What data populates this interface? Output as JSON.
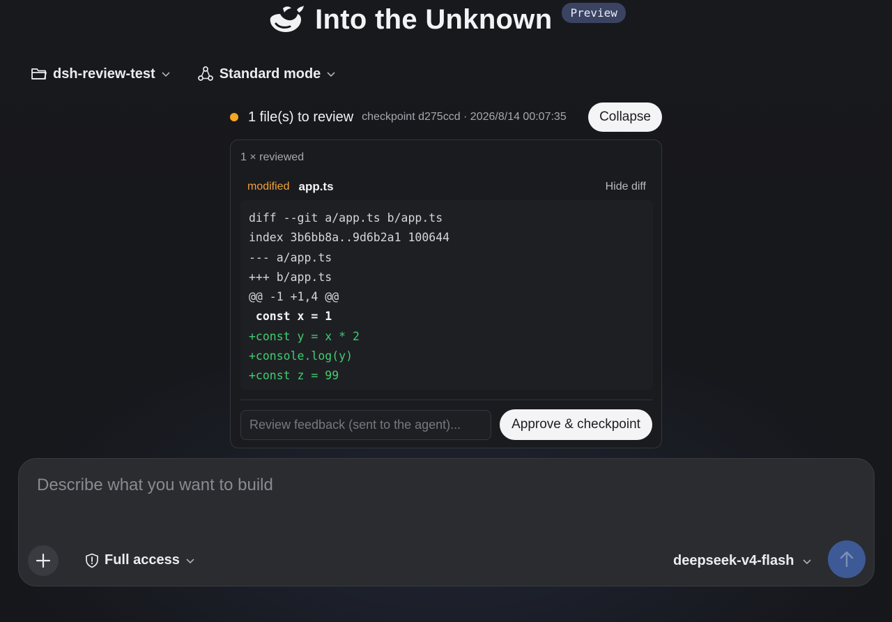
{
  "header": {
    "title": "Into the Unknown",
    "badge": "Preview"
  },
  "toolbar": {
    "folder_label": "dsh-review-test",
    "mode_label": "Standard mode"
  },
  "review": {
    "title": "1 file(s) to review",
    "meta": "checkpoint d275ccd · 2026/8/14 00:07:35",
    "collapse_label": "Collapse",
    "reviewed_count": "1 × reviewed",
    "file_status": "modified",
    "file_name": "app.ts",
    "hide_diff_label": "Hide diff",
    "diff_lines": [
      {
        "type": "meta",
        "text": "diff --git a/app.ts b/app.ts"
      },
      {
        "type": "meta",
        "text": "index 3b6bb8a..9d6b2a1 100644"
      },
      {
        "type": "meta",
        "text": "--- a/app.ts"
      },
      {
        "type": "meta",
        "text": "+++ b/app.ts"
      },
      {
        "type": "meta",
        "text": "@@ -1 +1,4 @@"
      },
      {
        "type": "ctx",
        "text": " const x = 1"
      },
      {
        "type": "add",
        "text": "+const y = x * 2"
      },
      {
        "type": "add",
        "text": "+console.log(y)"
      },
      {
        "type": "add",
        "text": "+const z = 99"
      }
    ],
    "feedback_placeholder": "Review feedback (sent to the agent)...",
    "approve_label": "Approve & checkpoint"
  },
  "composer": {
    "placeholder": "Describe what you want to build",
    "access_label": "Full access",
    "model_label": "deepseek-v4-flash"
  },
  "icons": {
    "logo": "whale-logo-icon",
    "folder": "folder-icon",
    "mode": "agents-icon",
    "plus": "plus-icon",
    "shield": "shield-icon",
    "send": "arrow-up-icon"
  },
  "colors": {
    "accent_orange": "#f5a623",
    "diff_add_green": "#3ecf6e",
    "send_blue": "#3d5a96",
    "badge_bg": "#3a4361"
  }
}
